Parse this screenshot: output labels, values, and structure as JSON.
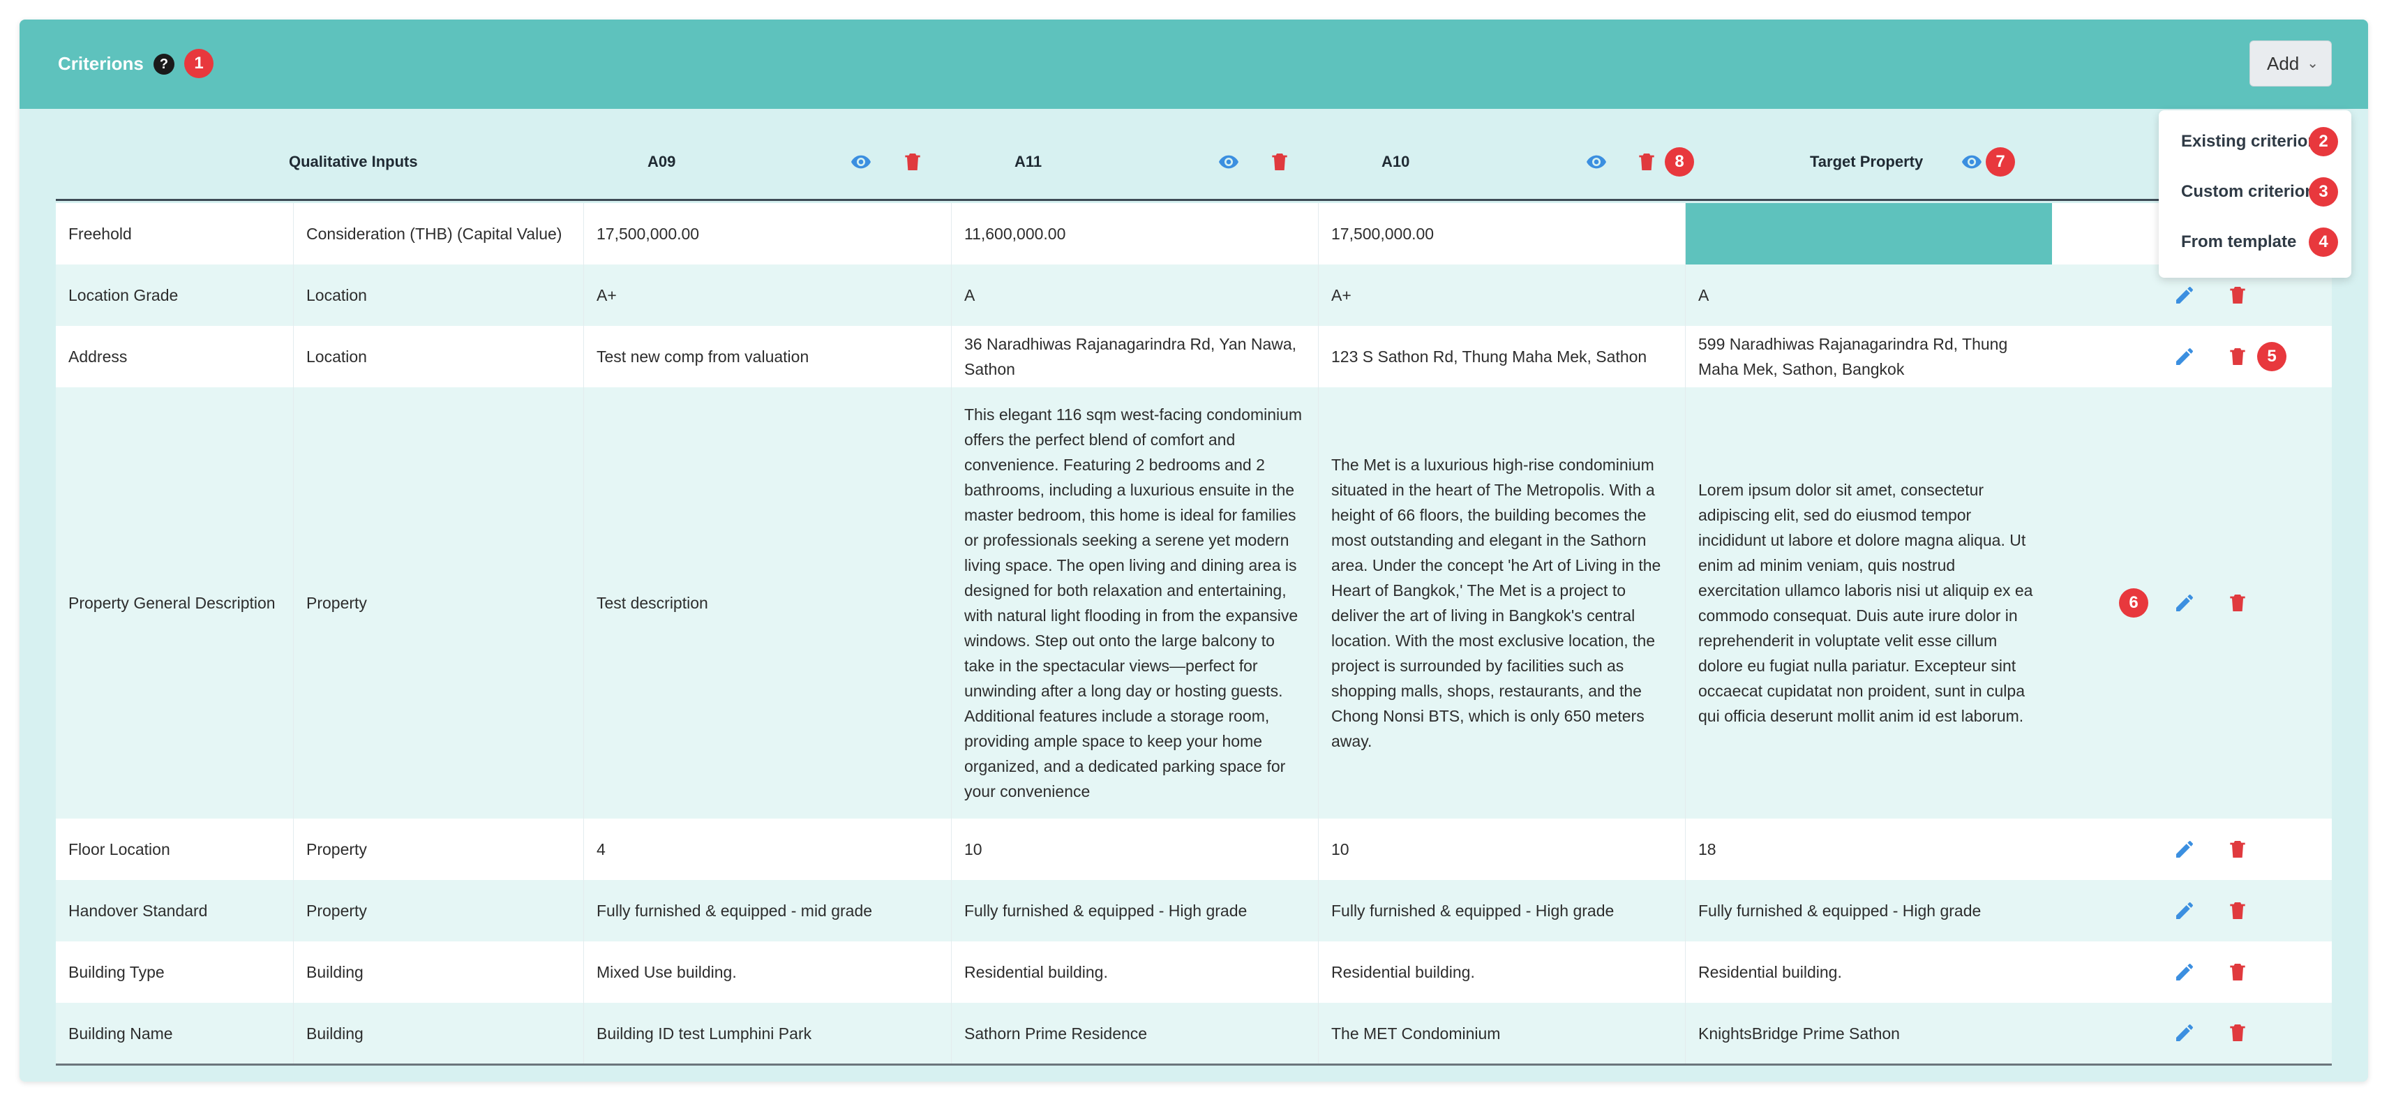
{
  "header": {
    "title": "Criterions",
    "add_label": "Add",
    "help_icon": "question-circle-icon"
  },
  "dropdown": {
    "items": [
      "Existing criterion",
      "Custom criterion",
      "From template"
    ]
  },
  "badges": [
    "1",
    "2",
    "3",
    "4",
    "5",
    "6",
    "7",
    "8"
  ],
  "columns": {
    "qualitative": "Qualitative Inputs",
    "comps": [
      "A09",
      "A11",
      "A10"
    ],
    "target": "Target Property"
  },
  "rows": [
    {
      "name": "Freehold",
      "category": "Consideration (THB) (Capital Value)",
      "a09": "17,500,000.00",
      "a11": "11,600,000.00",
      "a10": "17,500,000.00",
      "target": ""
    },
    {
      "name": "Location Grade",
      "category": "Location",
      "a09": "A+",
      "a11": "A",
      "a10": "A+",
      "target": "A"
    },
    {
      "name": "Address",
      "category": "Location",
      "a09": "Test new comp from valuation",
      "a11": "36 Naradhiwas Rajanagarindra Rd, Yan Nawa, Sathon",
      "a10": "123 S Sathon Rd, Thung Maha Mek, Sathon",
      "target": "599 Naradhiwas Rajanagarindra Rd, Thung Maha Mek, Sathon, Bangkok"
    },
    {
      "name": "Property General Description",
      "category": "Property",
      "a09": "Test description",
      "a11": "This elegant 116 sqm west-facing condominium offers the perfect blend of comfort and convenience. Featuring 2 bedrooms and 2 bathrooms, including a luxurious ensuite in the master bedroom, this home is ideal for families or professionals seeking a serene yet modern living space. The open living and dining area is designed for both relaxation and entertaining, with natural light flooding in from the expansive windows. Step out onto the large balcony to take in the spectacular views—perfect for unwinding after a long day or hosting guests. Additional features include a storage room, providing ample space to keep your home organized, and a dedicated parking space for your convenience",
      "a10": "The Met is a luxurious high-rise condominium situated in the heart of The Metropolis. With a height of 66 floors, the building becomes the most outstanding and elegant in the Sathorn area. Under the concept 'he Art of Living in the Heart of Bangkok,' The Met is a project to deliver the art of living in Bangkok's central location. With the most exclusive location, the project is surrounded by facilities such as shopping malls, shops, restaurants, and the Chong Nonsi BTS, which is only 650 meters away.",
      "target": "Lorem ipsum dolor sit amet, consectetur adipiscing elit, sed do eiusmod tempor incididunt ut labore et dolore magna aliqua. Ut enim ad minim veniam, quis nostrud exercitation ullamco laboris nisi ut aliquip ex ea commodo consequat. Duis aute irure dolor in reprehenderit in voluptate velit esse cillum dolore eu fugiat nulla pariatur. Excepteur sint occaecat cupidatat non proident, sunt in culpa qui officia deserunt mollit anim id est laborum."
    },
    {
      "name": "Floor Location",
      "category": "Property",
      "a09": "4",
      "a11": "10",
      "a10": "10",
      "target": "18"
    },
    {
      "name": "Handover Standard",
      "category": "Property",
      "a09": "Fully furnished & equipped - mid grade",
      "a11": "Fully furnished & equipped - High grade",
      "a10": "Fully furnished & equipped - High grade",
      "target": "Fully furnished & equipped - High grade"
    },
    {
      "name": "Building Type",
      "category": "Building",
      "a09": "Mixed Use building.",
      "a11": "Residential building.",
      "a10": "Residential building.",
      "target": "Residential building."
    },
    {
      "name": "Building Name",
      "category": "Building",
      "a09": "Building ID test Lumphini Park",
      "a11": "Sathorn Prime Residence",
      "a10": "The MET Condominium",
      "target": "KnightsBridge Prime Sathon"
    }
  ],
  "colors": {
    "header_bg": "#5ec2bd",
    "panel_bg": "#d7f1f1",
    "badge": "#e8383d",
    "eye": "#3b8fe0",
    "trash": "#e03a3e"
  }
}
